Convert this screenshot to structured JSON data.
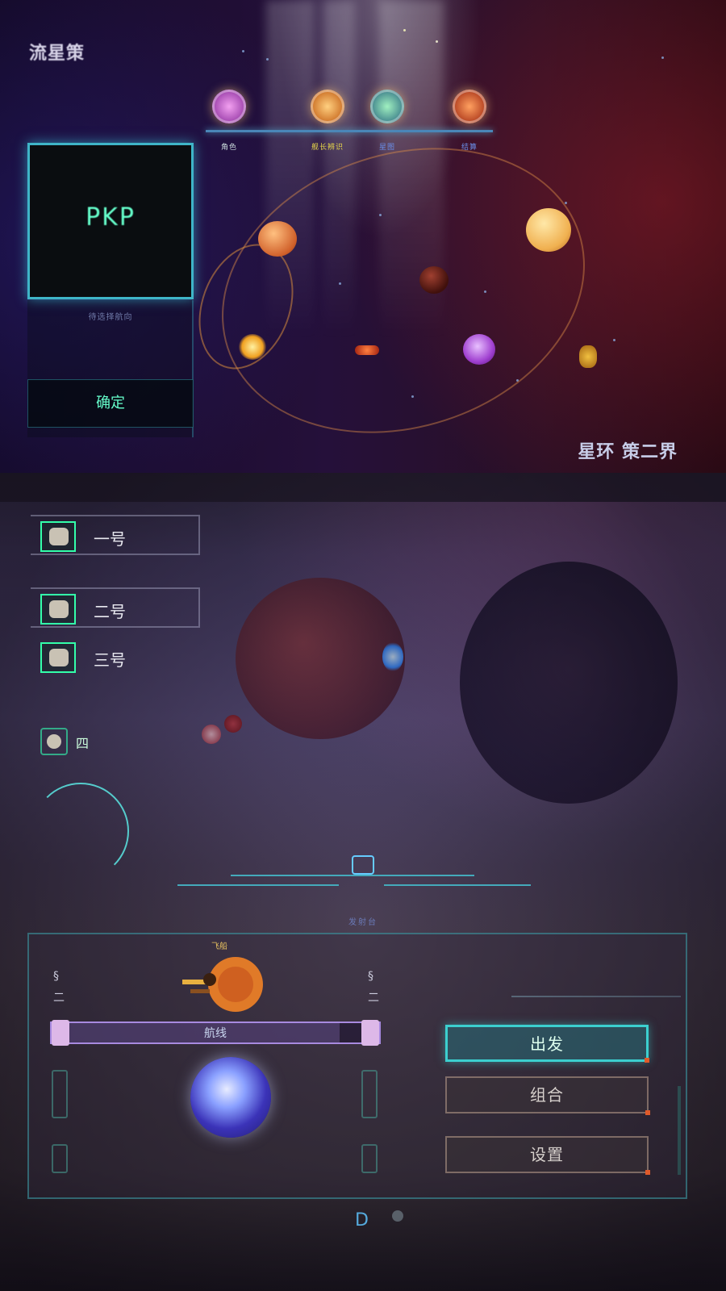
{
  "screen": {
    "game_title": "流星策",
    "sector_title": "星环 策二界"
  },
  "char_tabs": [
    {
      "label": "角色",
      "avatar_color": "#d070d8"
    },
    {
      "label": "舰长辨识",
      "avatar_color": "#f0a040"
    },
    {
      "label": "星图",
      "avatar_color": "#6cc0a0"
    },
    {
      "label": "结算",
      "avatar_color": "#e86a30"
    }
  ],
  "preview": {
    "text": "ΡΚΡ",
    "caption": "待选择航向",
    "select_label": "确定"
  },
  "crew": {
    "items": [
      {
        "label": "一号"
      },
      {
        "label": "二号"
      },
      {
        "label": "三号"
      }
    ],
    "mini_label": "四"
  },
  "launch": {
    "section_title": "发射台",
    "ship_label": "飞船",
    "left_ticks": [
      "§",
      "二"
    ],
    "right_ticks": [
      "§",
      "二"
    ],
    "bar_label": "航线",
    "bar_progress": 0.88
  },
  "menu": {
    "primary_label": "出发",
    "secondary_label_1": "组合",
    "secondary_label_2": "设置"
  },
  "footer": {
    "glyph": "D"
  },
  "colors": {
    "accent_cyan": "#3ccfcf",
    "accent_purple": "#a88ae0",
    "highlight_yellow": "#e8d84a"
  }
}
